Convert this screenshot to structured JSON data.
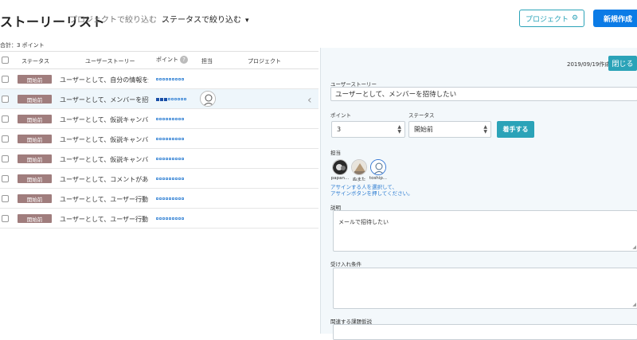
{
  "header": {
    "title": "ストーリーリスト",
    "filter_project": "プロジェクトで絞り込む",
    "filter_status": "ステータスで絞り込む",
    "project_button": "プロジェクト",
    "new_button": "新規作成"
  },
  "total": "合計：3 ポイント",
  "table": {
    "columns": [
      "ステータス",
      "ユーザーストーリー",
      "ポイント",
      "担当",
      "プロジェクト"
    ],
    "help_icon": "?",
    "rows": [
      {
        "status": "開始前",
        "story": "ユーザーとして、自分の情報を登録したい",
        "points": 0
      },
      {
        "status": "開始前",
        "story": "ユーザーとして、メンバーを招待したい",
        "points": 3
      },
      {
        "status": "開始前",
        "story": "ユーザーとして、仮説キャンバスを作成したい",
        "points": 0
      },
      {
        "status": "開始前",
        "story": "ユーザーとして、仮説キャンバスに入力したい",
        "points": 0
      },
      {
        "status": "開始前",
        "story": "ユーザーとして、仮説キャンバスに記入したい",
        "points": 0
      },
      {
        "status": "開始前",
        "story": "ユーザーとして、コメントがあったら通知がほしい",
        "points": 0
      },
      {
        "status": "開始前",
        "story": "ユーザーとして、ユーザー行動フローを作成したい",
        "points": 0
      },
      {
        "status": "開始前",
        "story": "ユーザーとして、ユーザー行動フローを編集したい",
        "points": 0
      }
    ]
  },
  "detail": {
    "created": "2019/09/19作成",
    "close_button": "閉じる",
    "story_label": "ユーザーストーリー",
    "story_value": "ユーザーとして、メンバーを招待したい",
    "points_label": "ポイント",
    "points_value": "3",
    "status_label": "ステータス",
    "status_value": "開始前",
    "start_button": "着手する",
    "assignee_label": "担当",
    "assignees": [
      "papan...",
      "ぬまた",
      "toship..."
    ],
    "assign_hint_1": "アサインする人を選択して、",
    "assign_hint_2": "アサインボタンを押してください。",
    "description_label": "説明",
    "description_value": "メールで招待したい",
    "acceptance_label": "受け入れ条件",
    "related_label": "関連する課題仮説"
  },
  "colors": {
    "accent": "#2ba3b8",
    "primary": "#0b7be6",
    "status_badge": "#a07d7d",
    "point_fill": "#1a4fa8"
  }
}
